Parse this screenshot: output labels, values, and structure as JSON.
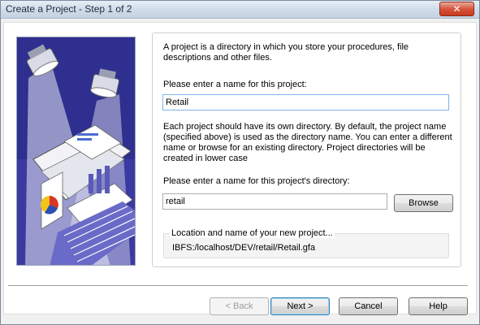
{
  "window": {
    "title": "Create a Project - Step 1 of 2",
    "close_glyph": "✕"
  },
  "content": {
    "intro": "A project is a directory in which you store your procedures, file descriptions and other files.",
    "name_prompt": "Please enter a name for this project:",
    "name_value": "Retail",
    "dir_info": "Each project should have its own directory. By default, the project name (specified above) is used as the directory name. You can enter a different name or browse for an existing directory. Project directories will be created in lower case",
    "dir_prompt": "Please enter a name for this project's directory:",
    "dir_value": "retail",
    "browse_label": "Browse",
    "location_legend": "Location and name of your new project...",
    "location_value": "IBFS:/localhost/DEV/retail/Retail.gfa"
  },
  "buttons": {
    "back": "< Back",
    "next": "Next >",
    "cancel": "Cancel",
    "help": "Help"
  },
  "icons": {
    "close": "close-icon",
    "illustration": "spotlight-presentation-illustration"
  },
  "colors": {
    "close_button": "#d7553c",
    "focus_border": "#7eb4ea",
    "default_button_border": "#3c7fb1"
  }
}
